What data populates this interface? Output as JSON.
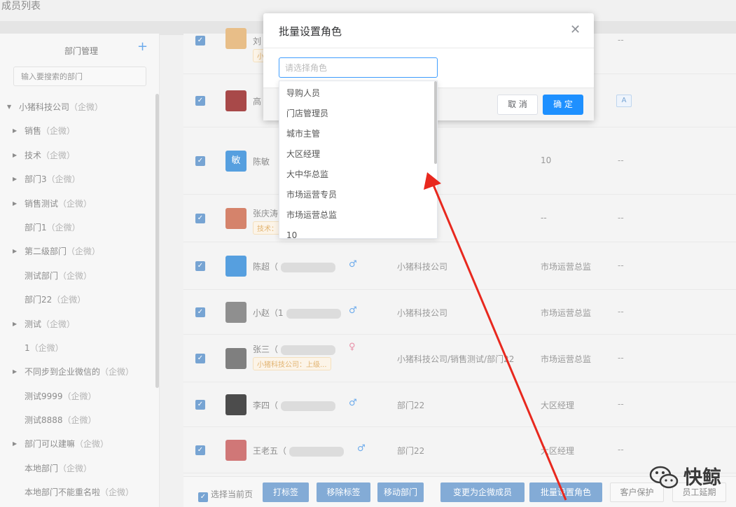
{
  "page": {
    "title": "成员列表"
  },
  "sidebar": {
    "title": "部门管理",
    "add_icon": "plus-icon",
    "search_placeholder": "输入要搜索的部门",
    "items": [
      {
        "label": "小猪科技公司",
        "suffix": "（企微）",
        "level": 0,
        "expanded": true
      },
      {
        "label": "销售",
        "suffix": "（企微）",
        "level": 1,
        "has_children": true
      },
      {
        "label": "技术",
        "suffix": "（企微）",
        "level": 1,
        "has_children": true
      },
      {
        "label": "部门3",
        "suffix": "（企微）",
        "level": 1,
        "has_children": true
      },
      {
        "label": "销售测试",
        "suffix": "（企微）",
        "level": 1,
        "has_children": true
      },
      {
        "label": "部门1",
        "suffix": "（企微）",
        "level": 1,
        "has_children": false
      },
      {
        "label": "第二级部门",
        "suffix": "（企微）",
        "level": 1,
        "has_children": true
      },
      {
        "label": "测试部门",
        "suffix": "（企微）",
        "level": 1,
        "has_children": false
      },
      {
        "label": "部门22",
        "suffix": "（企微）",
        "level": 1,
        "has_children": false
      },
      {
        "label": "测试",
        "suffix": "（企微）",
        "level": 1,
        "has_children": true
      },
      {
        "label": "1",
        "suffix": "（企微）",
        "level": 1,
        "has_children": false
      },
      {
        "label": "不同步到企业微信的",
        "suffix": "（企微）",
        "level": 1,
        "has_children": true
      },
      {
        "label": "测试9999",
        "suffix": "（企微）",
        "level": 1,
        "has_children": false
      },
      {
        "label": "测试8888",
        "suffix": "（企微）",
        "level": 1,
        "has_children": false
      },
      {
        "label": "部门可以建嘛",
        "suffix": "（企微）",
        "level": 1,
        "has_children": true
      },
      {
        "label": "本地部门",
        "suffix": "（企微）",
        "level": 1,
        "has_children": false
      },
      {
        "label": "本地部门不能重名啦",
        "suffix": "（企微）",
        "level": 1,
        "has_children": false
      }
    ]
  },
  "members": [
    {
      "name": "刘",
      "tag": "小",
      "dept": "",
      "role": "",
      "extra": "--",
      "avatar_color": "#e0a860"
    },
    {
      "name": "高",
      "tag": "",
      "dept": "",
      "role": "",
      "extra": "--",
      "badge": "A",
      "avatar_color": "#8b0d0d"
    },
    {
      "name": "陈敏",
      "tag": "",
      "dept": "",
      "role": "10",
      "extra": "--",
      "avatar_text": "敏",
      "avatar_color": "#1e7fd4"
    },
    {
      "name": "张庆涛",
      "tag": "技术：",
      "dept": "",
      "role": "--",
      "extra": "--",
      "avatar_color": "#c75a3a"
    },
    {
      "name": "陈超（",
      "gender": "♂",
      "dept": "小猪科技公司",
      "role": "市场运营总监",
      "extra": "--",
      "avatar_color": "#1e7fd4"
    },
    {
      "name": "小赵（1",
      "gender": "♂",
      "dept": "小猪科技公司",
      "role": "市场运营总监",
      "extra": "--",
      "avatar_color": "#6a6a6a"
    },
    {
      "name": "张三（",
      "gender": "♀",
      "tag": "小猪科技公司：上级...",
      "dept": "小猪科技公司/销售测试/部门22",
      "role": "市场运营总监",
      "extra": "--",
      "avatar_color": "#555"
    },
    {
      "name": "李四（",
      "gender": "♂",
      "dept": "部门22",
      "role": "大区经理",
      "extra": "--",
      "avatar_color": "#111"
    },
    {
      "name": "王老五（",
      "gender": "♂",
      "dept": "部门22",
      "role": "大区经理",
      "extra": "--",
      "avatar_color": "#c04a4a"
    }
  ],
  "toolbar": {
    "select_page": "选择当前页",
    "buttons": [
      "打标签",
      "移除标签",
      "移动部门",
      "变更为企微成员",
      "批量设置角色",
      "客户保护",
      "员工延期"
    ]
  },
  "dialog": {
    "title": "批量设置角色",
    "close_icon": "close-icon",
    "select_placeholder": "请选择角色",
    "cancel": "取 消",
    "confirm": "确 定"
  },
  "dropdown": {
    "options": [
      "导购人员",
      "门店管理员",
      "城市主管",
      "大区经理",
      "大中华总监",
      "市场运营专员",
      "市场运营总监",
      "10"
    ]
  },
  "watermark": {
    "text": "快鲸",
    "icon": "wechat-icon"
  },
  "colors": {
    "primary": "#1e90ff",
    "arrow": "#e8281e",
    "tag": "#d89a40"
  }
}
